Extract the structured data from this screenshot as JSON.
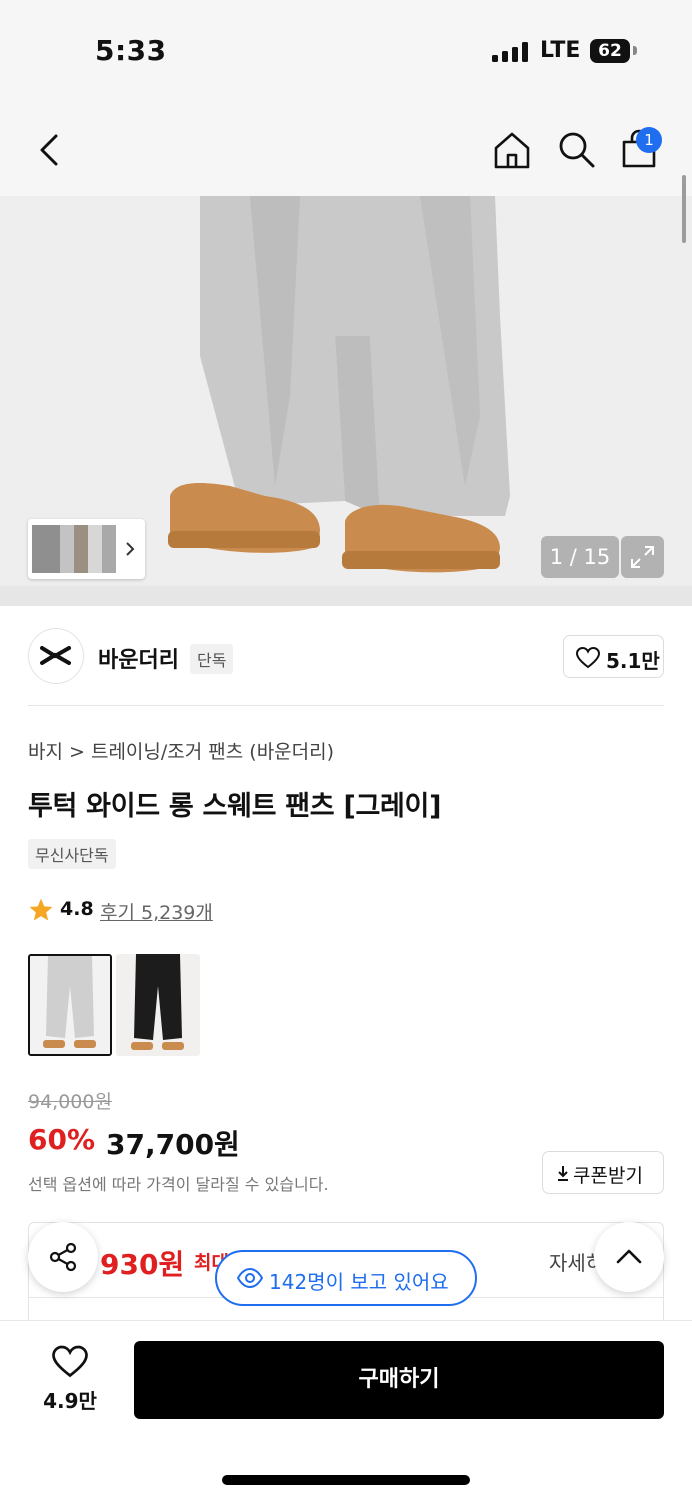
{
  "status": {
    "time": "5:33",
    "network": "LTE",
    "battery": "62"
  },
  "nav": {
    "cart_count": "1"
  },
  "gallery": {
    "counter": "1 / 15"
  },
  "brand": {
    "name": "바운더리",
    "tag": "단독",
    "likes": "5.1만"
  },
  "product": {
    "breadcrumb": "바지 > 트레이닝/조거 팬츠 (바운더리)",
    "title": "투턱 와이드 롱 스웨트 팬츠 [그레이]",
    "badge": "무신사단독",
    "rating": "4.8",
    "reviews": "후기 5,239개",
    "swatches": [
      {
        "color": "#cfcfcf"
      },
      {
        "color": "#1c1c1c"
      }
    ]
  },
  "price": {
    "original": "94,000원",
    "discount": "60%",
    "sale": "37,700원",
    "note": "선택 옵션에 따라 가격이 달라질 수 있습니다.",
    "coupon_label": "쿠폰받기"
  },
  "benefit": {
    "price": "930원",
    "label": "최대",
    "detail": "자세히"
  },
  "viewers": "142명이 보고 있어요",
  "bottom": {
    "wish_count": "4.9만",
    "buy_label": "구매하기"
  },
  "colors": {
    "accent": "#1f6ef0",
    "sale": "#e02020",
    "star": "#f5a623"
  }
}
